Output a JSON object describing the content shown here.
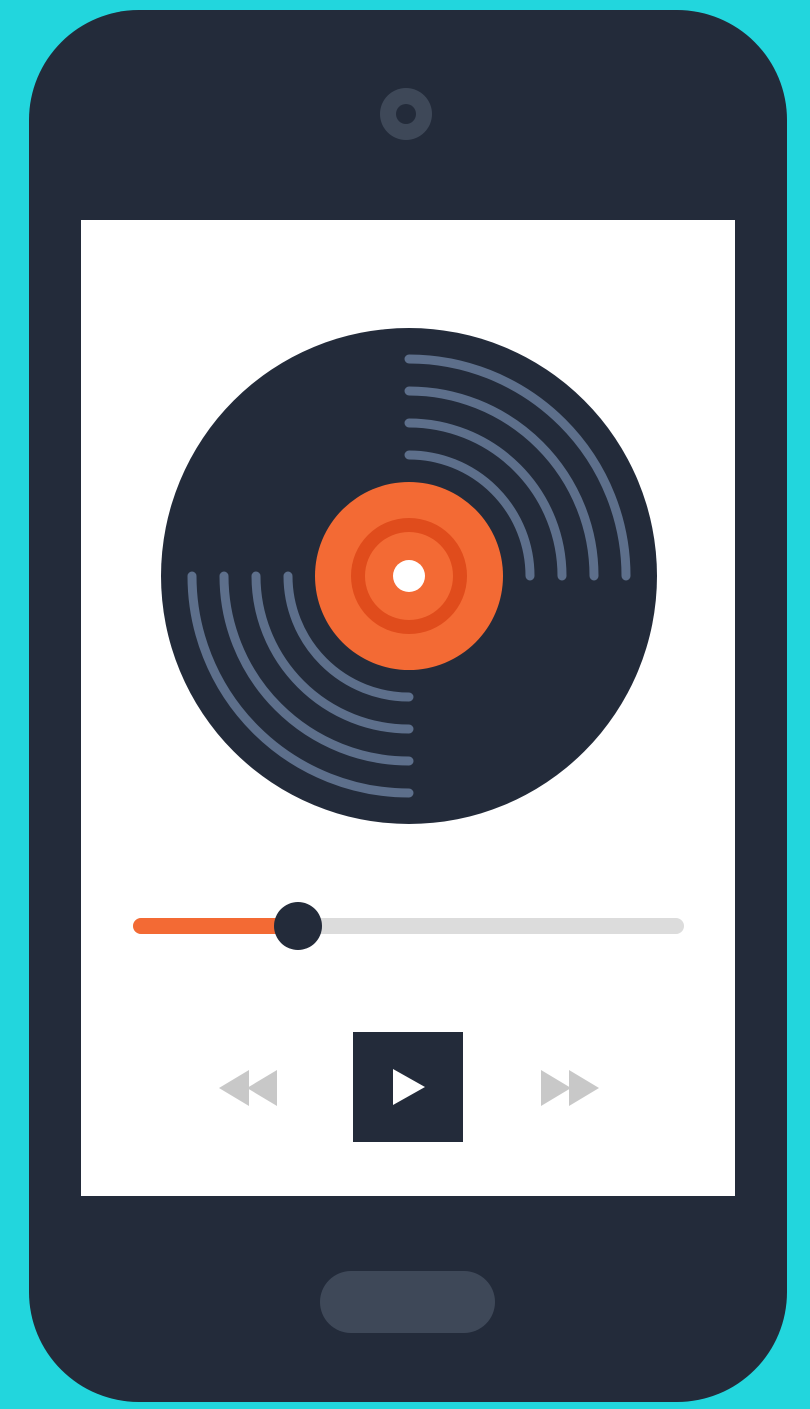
{
  "player": {
    "progress_fraction": 0.3,
    "state": "paused"
  },
  "icons": {
    "camera": "camera-icon",
    "record": "vinyl-record-icon",
    "rewind": "rewind-icon",
    "play": "play-icon",
    "forward": "fast-forward-icon",
    "home": "home-button"
  },
  "colors": {
    "background": "#22d6dd",
    "phone_body": "#232b3a",
    "screen": "#ffffff",
    "accent": "#f36a34",
    "groove": "#5d6f8b",
    "track": "#dcdcdc",
    "inactive_control": "#c8c8c8"
  }
}
